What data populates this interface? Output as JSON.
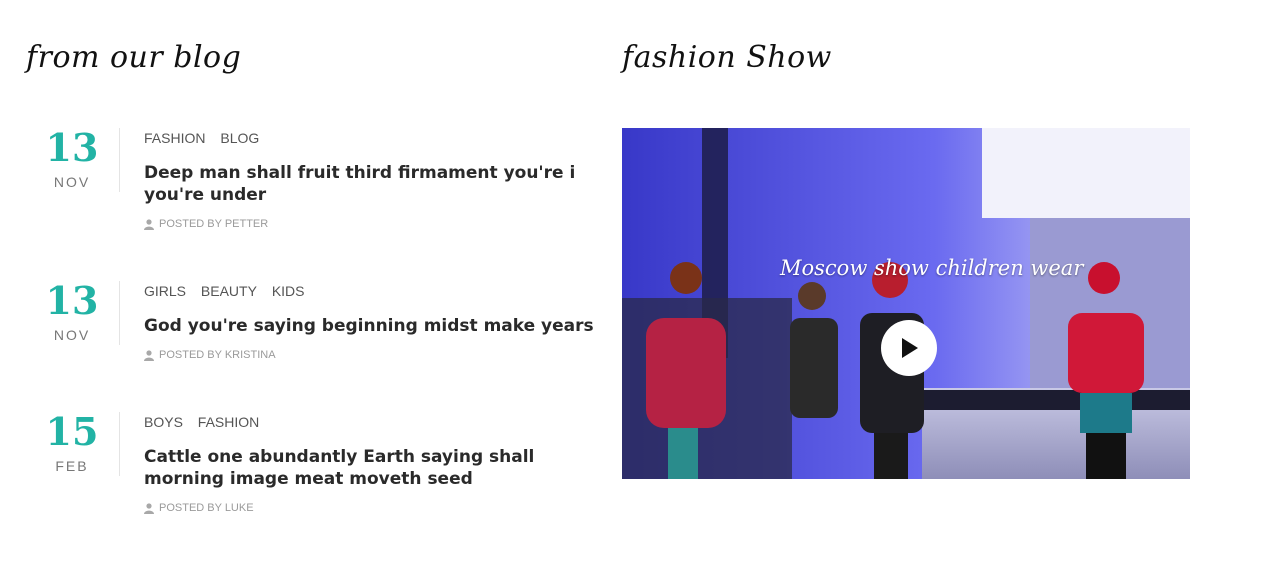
{
  "blog": {
    "title": "from our blog",
    "posts": [
      {
        "day": "13",
        "month": "NOV",
        "tags": [
          "FASHION",
          "BLOG"
        ],
        "title": "Deep man shall fruit third firmament you're i you're under",
        "author": "POSTED BY PETTER"
      },
      {
        "day": "13",
        "month": "NOV",
        "tags": [
          "GIRLS",
          "BEAUTY",
          "KIDS"
        ],
        "title": "God you're saying beginning midst make years",
        "author": "POSTED BY KRISTINA"
      },
      {
        "day": "15",
        "month": "FEB",
        "tags": [
          "BOYS",
          "FASHION"
        ],
        "title": "Cattle one abundantly Earth saying shall morning image meat moveth seed",
        "author": "POSTED BY LUKE"
      }
    ]
  },
  "fashion": {
    "title": "fashion Show",
    "video_caption": "Moscow show children wear",
    "play_icon": "play-icon"
  },
  "colors": {
    "accent": "#22b3a5",
    "text": "#2a2a2a",
    "muted": "#9a9a9a"
  }
}
